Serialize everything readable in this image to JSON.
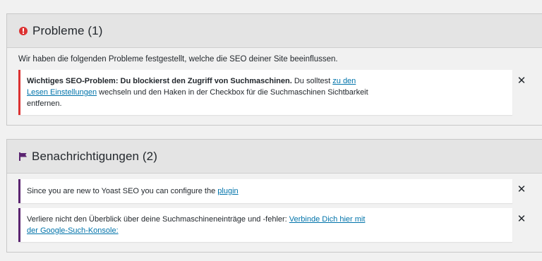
{
  "problems": {
    "title": "Probleme (1)",
    "intro": "Wir haben die folgenden Probleme festgestellt, welche die SEO deiner Site beeinflussen.",
    "items": [
      {
        "bold": "Wichtiges SEO-Problem: Du blockierst den Zugriff von Suchmaschinen.",
        "text_before_link": " Du solltest ",
        "link_line1": "zu den",
        "link_line2": "Lesen Einstellungen",
        "text_after_link": " wechseln und den Haken in der Checkbox für die Suchmaschinen Sichtbarkeit",
        "text_line3": "entfernen.",
        "dismiss": "✕"
      }
    ],
    "accent": "#dc3232"
  },
  "notifications": {
    "title": "Benachrichtigungen (2)",
    "items": [
      {
        "text": "Since you are new to Yoast SEO you can configure the ",
        "link": "plugin",
        "dismiss": "✕"
      },
      {
        "text": "Verliere nicht den Überblick über deine Suchmaschineneinträge und -fehler: ",
        "link_line1": "Verbinde Dich hier mit",
        "link_line2": "der Google-Such-Konsole:",
        "dismiss": "✕"
      }
    ],
    "accent": "#5b2571"
  },
  "icons": {
    "problems": "exclamation-circle-icon",
    "notifications": "flag-icon",
    "dismiss": "close-icon"
  },
  "colors": {
    "link": "#0073aa",
    "background": "#f1f1f1",
    "header": "#e4e4e4"
  }
}
